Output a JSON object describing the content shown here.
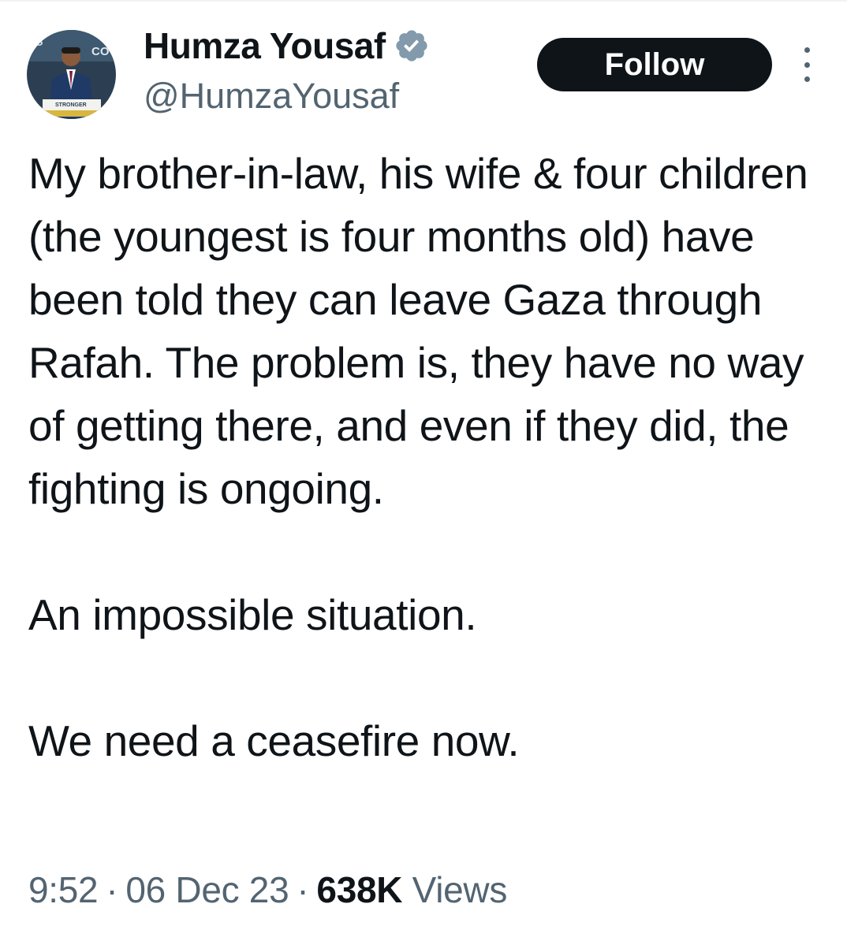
{
  "author": {
    "display_name": "Humza Yousaf",
    "handle": "@HumzaYousaf",
    "verified_icon": "verified-badge-icon",
    "avatar_icon": "profile-photo"
  },
  "follow_button": {
    "label": "Follow"
  },
  "more_menu": {
    "icon": "more-options-icon"
  },
  "tweet": {
    "paragraphs": [
      "My brother-in-law, his wife & four children (the youngest is four months old) have been told they can leave Gaza through Rafah. The problem is, they have no way of getting there, and even if they did, the fighting is ongoing.",
      "An impossible situation.",
      "We need a ceasefire now."
    ]
  },
  "meta": {
    "time": "9:52",
    "separator": "·",
    "date": "06 Dec 23",
    "views_count": "638K",
    "views_label": "Views"
  },
  "colors": {
    "text_primary": "#0f1419",
    "text_secondary": "#536471",
    "button_bg": "#0f1419",
    "badge": "#829aab"
  }
}
